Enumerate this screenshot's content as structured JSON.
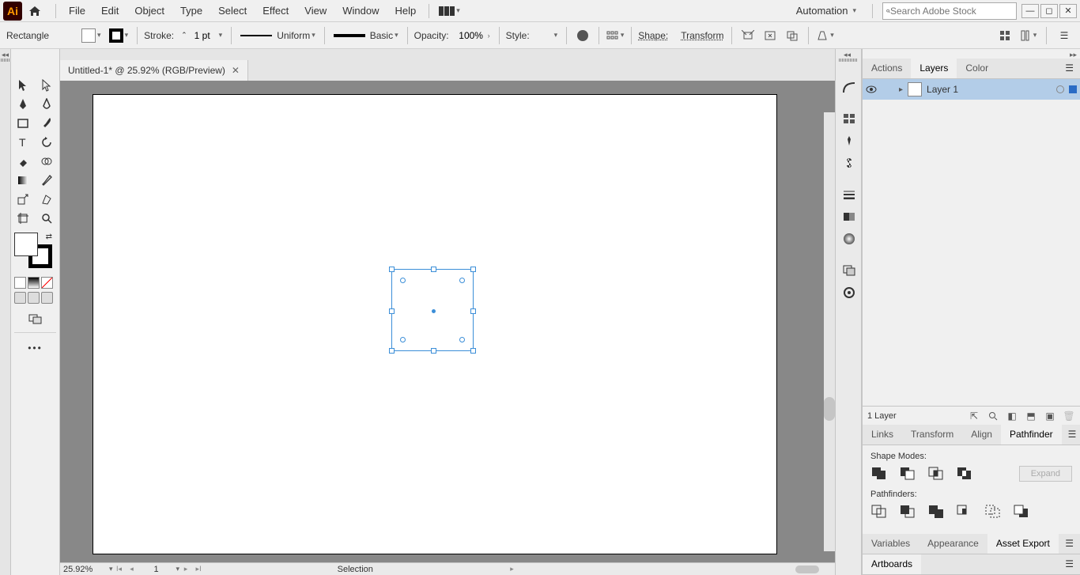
{
  "app": {
    "logo_text": "Ai"
  },
  "menu": {
    "items": [
      "File",
      "Edit",
      "Object",
      "Type",
      "Select",
      "Effect",
      "View",
      "Window",
      "Help"
    ]
  },
  "automation_label": "Automation",
  "search_placeholder": "Search Adobe Stock",
  "control": {
    "shape_name": "Rectangle",
    "stroke_label": "Stroke:",
    "stroke_value": "1 pt",
    "profile_label": "Uniform",
    "brush_label": "Basic",
    "opacity_label": "Opacity:",
    "opacity_value": "100%",
    "style_label": "Style:",
    "shape_btn": "Shape:",
    "transform_btn": "Transform"
  },
  "doc": {
    "tab_title": "Untitled-1* @ 25.92% (RGB/Preview)"
  },
  "status": {
    "zoom": "25.92%",
    "artboard": "1",
    "tool": "Selection"
  },
  "panels": {
    "top_tabs": [
      "Actions",
      "Layers",
      "Color"
    ],
    "top_active": "Layers",
    "layer_name": "Layer 1",
    "layer_count": "1 Layer",
    "mid_tabs": [
      "Links",
      "Transform",
      "Align",
      "Pathfinder"
    ],
    "mid_active": "Pathfinder",
    "shape_modes": "Shape Modes:",
    "pathfinders": "Pathfinders:",
    "expand": "Expand",
    "bot_tabs": [
      "Variables",
      "Appearance",
      "Asset Export"
    ],
    "bot_active": "Asset Export",
    "artboards_tab": "Artboards"
  }
}
